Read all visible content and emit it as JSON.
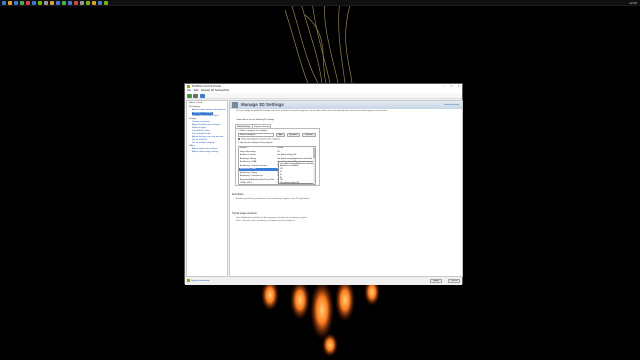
{
  "taskbar": {
    "icons": [
      "#3c7bd9",
      "#e0a020",
      "#3c7bd9",
      "#4caf50",
      "#d94040",
      "#3c7bd9",
      "#76b900",
      "#9a9a9a",
      "#e0a020",
      "#3c7bd9",
      "#4caf50",
      "#3c7bd9",
      "#d94040",
      "#9a9a9a",
      "#76b900",
      "#e0a020",
      "#3c7bd9",
      "#76b900"
    ],
    "tray_time": "12:00"
  },
  "window": {
    "title": "NVIDIA Control Panel",
    "accent": "#76b900",
    "menu": [
      "File",
      "Edit",
      "Desktop",
      "3D Settings",
      "Help"
    ],
    "toolbar": {
      "back_label": "Back",
      "forward_label": "Forward",
      "home_label": "Home"
    },
    "tree": {
      "header": "Select a Task...",
      "items": [
        {
          "label": "3D Settings",
          "kind": "cat"
        },
        {
          "label": "Adjust image settings with preview",
          "kind": "link"
        },
        {
          "label": "Manage 3D settings",
          "kind": "sel"
        },
        {
          "label": "Configure Surround, PhysX",
          "kind": "link"
        },
        {
          "label": "Display",
          "kind": "cat"
        },
        {
          "label": "Change resolution",
          "kind": "link"
        },
        {
          "label": "Adjust desktop color settings",
          "kind": "link"
        },
        {
          "label": "Rotate display",
          "kind": "link"
        },
        {
          "label": "View HDCP status",
          "kind": "link"
        },
        {
          "label": "Set up digital audio",
          "kind": "link"
        },
        {
          "label": "Adjust desktop size and position",
          "kind": "link"
        },
        {
          "label": "Set up G-SYNC",
          "kind": "link"
        },
        {
          "label": "Set up multiple displays",
          "kind": "link"
        },
        {
          "label": "Video",
          "kind": "cat"
        },
        {
          "label": "Adjust video color settings",
          "kind": "link"
        },
        {
          "label": "Adjust video image settings",
          "kind": "link"
        }
      ]
    },
    "main": {
      "title": "Manage 3D Settings",
      "restore_label": "Restore Defaults",
      "description": "You can change the global 3D settings and create overrides for specific programs. The overrides will be used automatically each time the specified programs are launched.",
      "prompt": "I would like to use the following 3D settings:",
      "tabs": [
        "Global Settings",
        "Program Settings"
      ],
      "program_label": "1. Select a program to customize:",
      "program_value": "Select a program",
      "add_label": "Add",
      "remove_label": "Remove",
      "restore_btn_label": "Restore",
      "show_only_label": "Show only programs found on this computer",
      "settings_label": "2. Specify the settings for this program:",
      "header_feature": "Feature",
      "header_setting": "Setting",
      "settings": [
        {
          "feature": "Feature",
          "value": "Setting"
        },
        {
          "feature": "Image Sharpening",
          "value": "Off"
        },
        {
          "feature": "Ambient Occlusion",
          "value": "Use global setting (Off)"
        },
        {
          "feature": "Anisotropic filtering",
          "value": "Use global setting (Application-controlled)"
        },
        {
          "feature": "Antialiasing - FXAA",
          "value": "Use global setting (Off)"
        },
        {
          "feature": "Antialiasing - Gamma correction",
          "value": "Use global setting (On)"
        },
        {
          "feature": "Antialiasing - Mode",
          "value": "Use global setting (Application-controlled)"
        },
        {
          "feature": "Antialiasing - Setting",
          "value": "Use global setting (Application-controlled)"
        },
        {
          "feature": "Antialiasing - Transparency",
          "value": "Use global setting (Off)"
        },
        {
          "feature": "Background Application Max Frame Rate",
          "value": "Use global setting (Off)"
        },
        {
          "feature": "CUDA - GPUs",
          "value": "Use global setting (All)"
        }
      ],
      "dropdown_options": [
        "Use global setting (Application-controlled)",
        "Application-controlled",
        "Off",
        "2x",
        "4x",
        "8x",
        "16x",
        "Use global setting (Off)"
      ],
      "description_heading": "Description:",
      "description_text": "Antialiasing mode lets you determine how antialiasing is applied in your 3D applications.",
      "usage_heading": "Typical usage scenarios:",
      "usage_lines": [
        "Select 'Application-controlled' to allow programs to decide how antialiasing is applied",
        "Select 'Override' to force antialiasing in programs that do not support it"
      ]
    },
    "statusbar": {
      "system_info_label": "System Information",
      "apply_label": "Apply",
      "cancel_label": "Cancel"
    }
  }
}
